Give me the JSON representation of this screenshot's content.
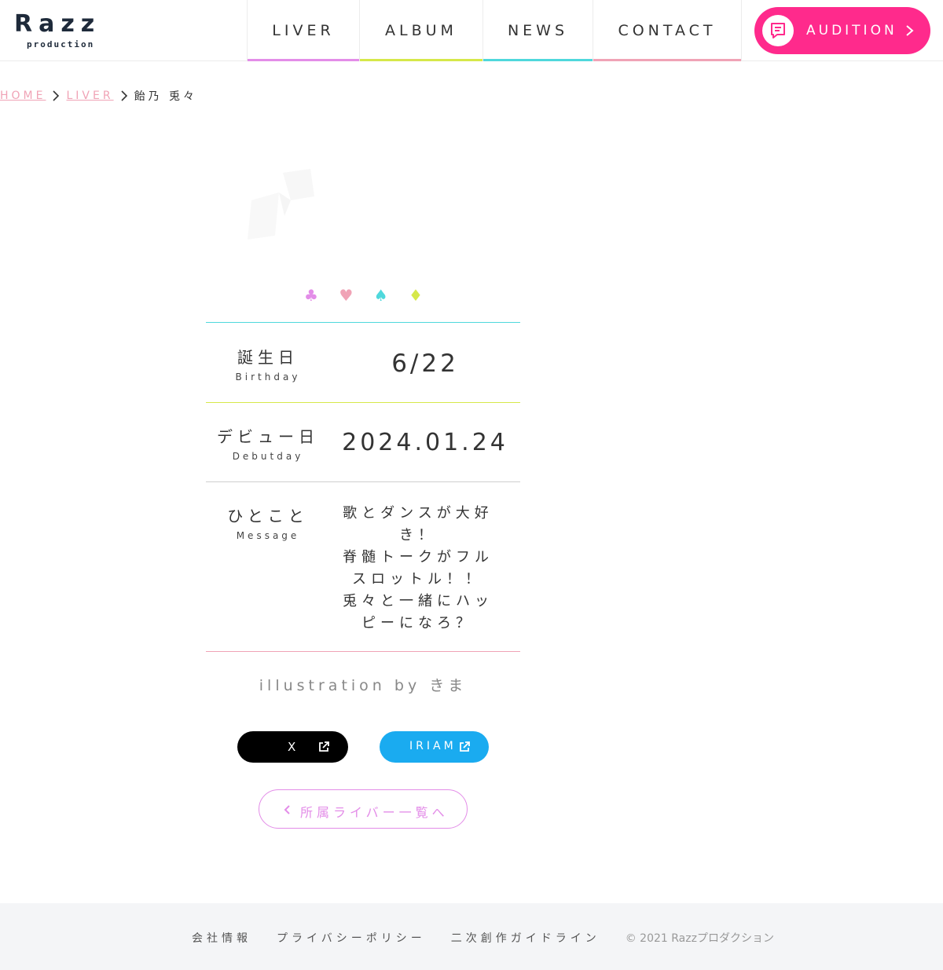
{
  "header": {
    "logo_text": "Razz",
    "logo_sub": "production",
    "nav": [
      {
        "label": "LIVER"
      },
      {
        "label": "ALBUM"
      },
      {
        "label": "NEWS"
      },
      {
        "label": "CONTACT"
      }
    ],
    "audition_label": "AUDITION"
  },
  "breadcrumb": {
    "home": "HOME",
    "liver": "LIVER",
    "current": "飴乃 兎々"
  },
  "suits": [
    "♣",
    "♥",
    "♠",
    "♦"
  ],
  "profile": {
    "birthday": {
      "label_jp": "誕生日",
      "label_en": "Birthday",
      "value": "6/22"
    },
    "debut": {
      "label_jp": "デビュー日",
      "label_en": "Debutday",
      "value": "2024.01.24"
    },
    "message": {
      "label_jp": "ひとこと",
      "label_en": "Message",
      "value": "歌とダンスが大好き！\n脊髄トークがフルスロットル！！\n兎々と一緒にハッピーになろ？"
    }
  },
  "illustration": "illustration by きま",
  "social": {
    "x_label": "X",
    "iriam_label": "IRIAM"
  },
  "back_label": "所属ライバー一覧へ",
  "footer": {
    "links": [
      "会社情報",
      "プライバシーポリシー",
      "二次創作ガイドライン"
    ],
    "copyright": "© 2021 Razzプロダクション"
  },
  "colors": {
    "pink": "#ff2a8c",
    "violet": "#e38de8",
    "lime": "#d6e84a",
    "cyan": "#4fd8dc",
    "rose": "#f0a3b6",
    "iriam_blue": "#1aabf0"
  }
}
